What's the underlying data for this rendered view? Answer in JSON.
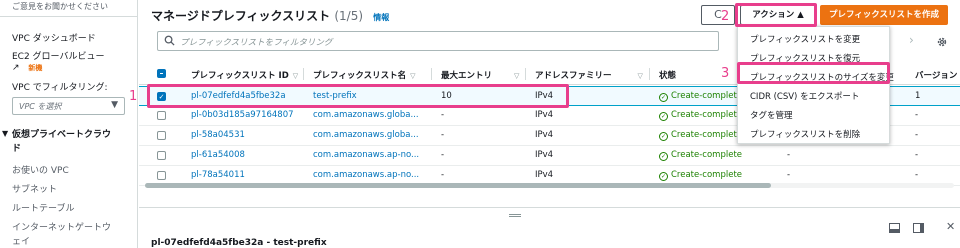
{
  "sidebar": {
    "feedback": "ご意見をお聞かせください",
    "items": [
      {
        "label": "VPC ダッシュボード"
      },
      {
        "label": "EC2 グローバルビュー"
      },
      {
        "label": "新機"
      },
      {
        "label": "VPC でフィルタリング:"
      },
      {
        "label": "仮想プライベートクラウ"
      },
      {
        "label": "ド"
      },
      {
        "label": "お使いの VPC"
      },
      {
        "label": "サブネット"
      },
      {
        "label": "ルートテーブル"
      },
      {
        "label": "インターネットゲートウ"
      },
      {
        "label": "ェイ"
      }
    ],
    "vpc_select_placeholder": "VPC を選択"
  },
  "header": {
    "title": "マネージドプレフィックスリスト",
    "count": "(1/5)",
    "info": "情報",
    "refresh_icon": "C",
    "action_label": "アクション ▲",
    "create_label": "プレフィックスリストを作成"
  },
  "search": {
    "placeholder": "プレフィックスリストをフィルタリング"
  },
  "table": {
    "columns": [
      "プレフィックスリスト ID",
      "プレフィックスリスト名",
      "最大エントリ",
      "アドレスファミリー",
      "状態",
      "バージョン"
    ],
    "rows": [
      {
        "id": "pl-07edfefd4a5fbe32a",
        "name": "test-prefix",
        "max": "10",
        "family": "IPv4",
        "state": "Create-complete",
        "extra": "",
        "version": "1",
        "check": "✓"
      },
      {
        "id": "pl-0b03d185a97164807",
        "name": "com.amazonaws.globa...",
        "max": "-",
        "family": "IPv4",
        "state": "Create-complete",
        "extra": "",
        "version": "-",
        "check": ""
      },
      {
        "id": "pl-58a04531",
        "name": "com.amazonaws.globa...",
        "max": "-",
        "family": "IPv4",
        "state": "Create-complete",
        "extra": "",
        "version": "-",
        "check": ""
      },
      {
        "id": "pl-61a54008",
        "name": "com.amazonaws.ap-no...",
        "max": "-",
        "family": "IPv4",
        "state": "Create-complete",
        "extra": "-",
        "version": "-",
        "check": ""
      },
      {
        "id": "pl-78a54011",
        "name": "com.amazonaws.ap-no...",
        "max": "-",
        "family": "IPv4",
        "state": "Create-complete",
        "extra": "-",
        "version": "-",
        "check": ""
      }
    ]
  },
  "dropdown": {
    "items": [
      "プレフィックスリストを変更",
      "プレフィックスリストを復元",
      "プレフィックスリストのサイズを変更",
      "CIDR (CSV) をエクスポート",
      "タグを管理",
      "プレフィックスリストを削除"
    ]
  },
  "annotations": {
    "step1": "1",
    "step2": "2",
    "step3": "3"
  },
  "split_panel": {
    "title": "pl-07edfefd4a5fbe32a - test-prefix"
  },
  "icons": {
    "close": "✕",
    "pager": "›",
    "check_ok": "✓",
    "caret": "▼",
    "collapse": "▼",
    "external": "↗"
  },
  "colors": {
    "accent": "#0073bb",
    "primary_button": "#ec7211",
    "success": "#1d8102",
    "annotation": "#e83e8c"
  }
}
